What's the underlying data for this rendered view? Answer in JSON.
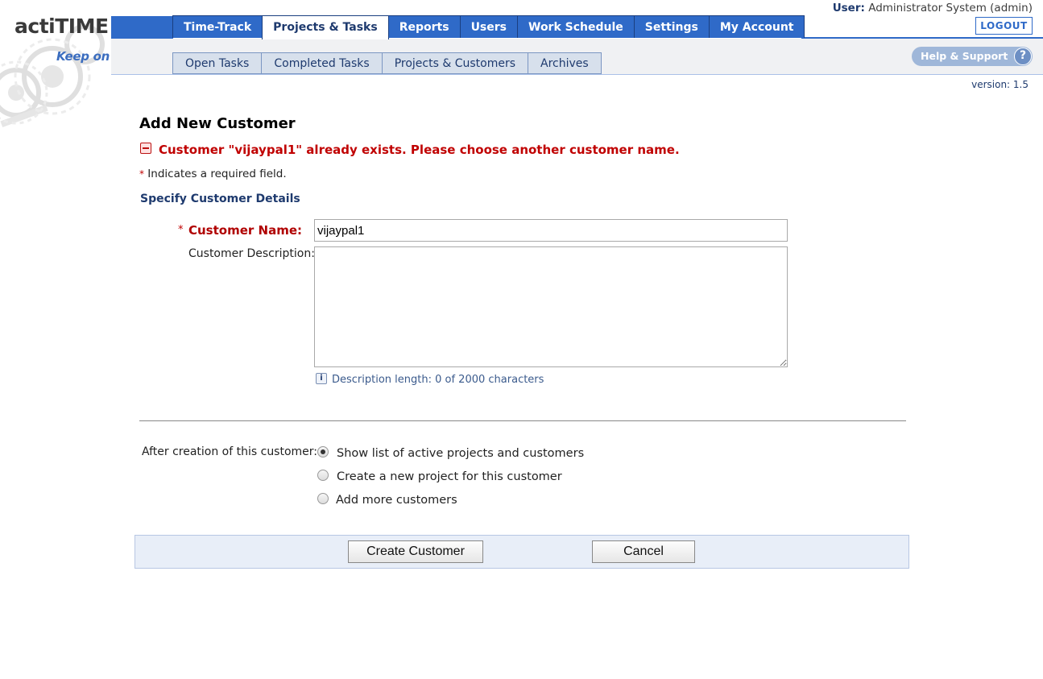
{
  "header": {
    "logo": {
      "prefix": "acti",
      "suffix": "TIME"
    },
    "tagline": "Keep on trackin’",
    "user_label": "User:",
    "user_value": "Administrator System (admin)",
    "logout_label": "LOGOUT",
    "help_label": "Help & Support",
    "help_icon": "?",
    "version": "version: 1.5"
  },
  "main_tabs": [
    {
      "label": "Time-Track",
      "active": false
    },
    {
      "label": "Projects & Tasks",
      "active": true
    },
    {
      "label": "Reports",
      "active": false
    },
    {
      "label": "Users",
      "active": false
    },
    {
      "label": "Work Schedule",
      "active": false
    },
    {
      "label": "Settings",
      "active": false
    },
    {
      "label": "My Account",
      "active": false
    }
  ],
  "sub_tabs": [
    {
      "label": "Open Tasks"
    },
    {
      "label": "Completed Tasks"
    },
    {
      "label": "Projects & Customers"
    },
    {
      "label": "Archives"
    }
  ],
  "page": {
    "title": "Add New Customer",
    "error": "Customer \"vijaypal1\" already exists. Please choose another customer name.",
    "required_star": "*",
    "required_note": "Indicates a required field.",
    "section_title": "Specify Customer Details"
  },
  "form": {
    "name_label": "Customer Name:",
    "name_value": "vijaypal1",
    "description_label": "Customer Description:",
    "description_value": "",
    "description_info_icon": "i",
    "description_length": "Description length: 0 of 2000 characters",
    "after_label": "After creation of this customer:",
    "options": [
      {
        "label": "Show list of active projects and customers",
        "checked": true
      },
      {
        "label": "Create a new project for this customer",
        "checked": false
      },
      {
        "label": "Add more customers",
        "checked": false
      }
    ]
  },
  "buttons": {
    "create": "Create Customer",
    "cancel": "Cancel"
  },
  "colors": {
    "tab_blue": "#2f6ac8",
    "error_red": "#c00000",
    "section_blue": "#1e3a6e"
  }
}
